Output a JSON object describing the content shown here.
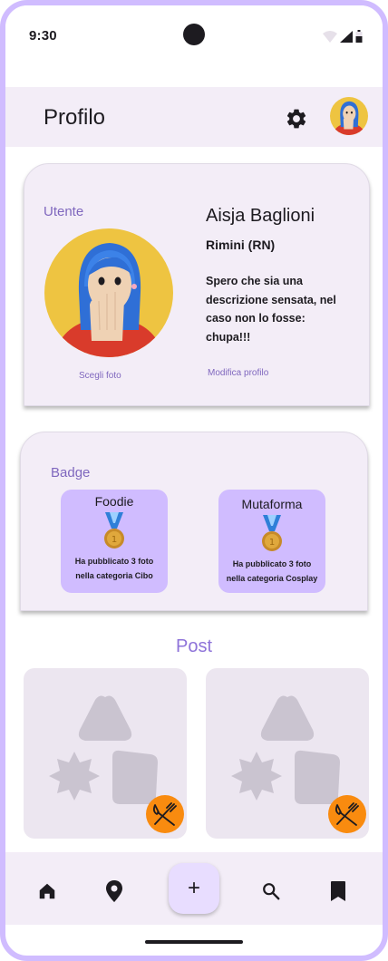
{
  "status_bar": {
    "time": "9:30"
  },
  "app_bar": {
    "title": "Profilo"
  },
  "user_card": {
    "label": "Utente",
    "name": "Aisja Baglioni",
    "city": "Rimini (RN)",
    "bio": "Spero che sia una descrizione sensata, nel caso non lo fosse: chupa!!!",
    "choose_photo": "Scegli foto",
    "edit_profile": "Modifica profilo"
  },
  "badges": {
    "label": "Badge",
    "items": [
      {
        "title": "Foodie",
        "description": "Ha pubblicato 3 foto nella categoria Cibo",
        "icon": "medal-icon"
      },
      {
        "title": "Mutaforma",
        "description": "Ha pubblicato 3 foto nella categoria Cosplay",
        "icon": "medal-icon"
      }
    ]
  },
  "posts": {
    "title": "Post",
    "items": [
      {
        "category_icon": "fork-knife-icon",
        "category_color": "#f98b0f"
      },
      {
        "category_icon": "fork-knife-icon",
        "category_color": "#f98b0f"
      }
    ]
  },
  "bottom_nav": {
    "items": [
      {
        "icon": "home-icon"
      },
      {
        "icon": "location-pin-icon"
      },
      {
        "icon": "add-icon",
        "label": "+"
      },
      {
        "icon": "search-icon"
      },
      {
        "icon": "bookmark-icon"
      }
    ]
  },
  "colors": {
    "accent": "#7f67be",
    "surface": "#f3edf7",
    "badge_bg": "#d0bcff",
    "frame": "#d0bcff",
    "category": "#f98b0f"
  }
}
